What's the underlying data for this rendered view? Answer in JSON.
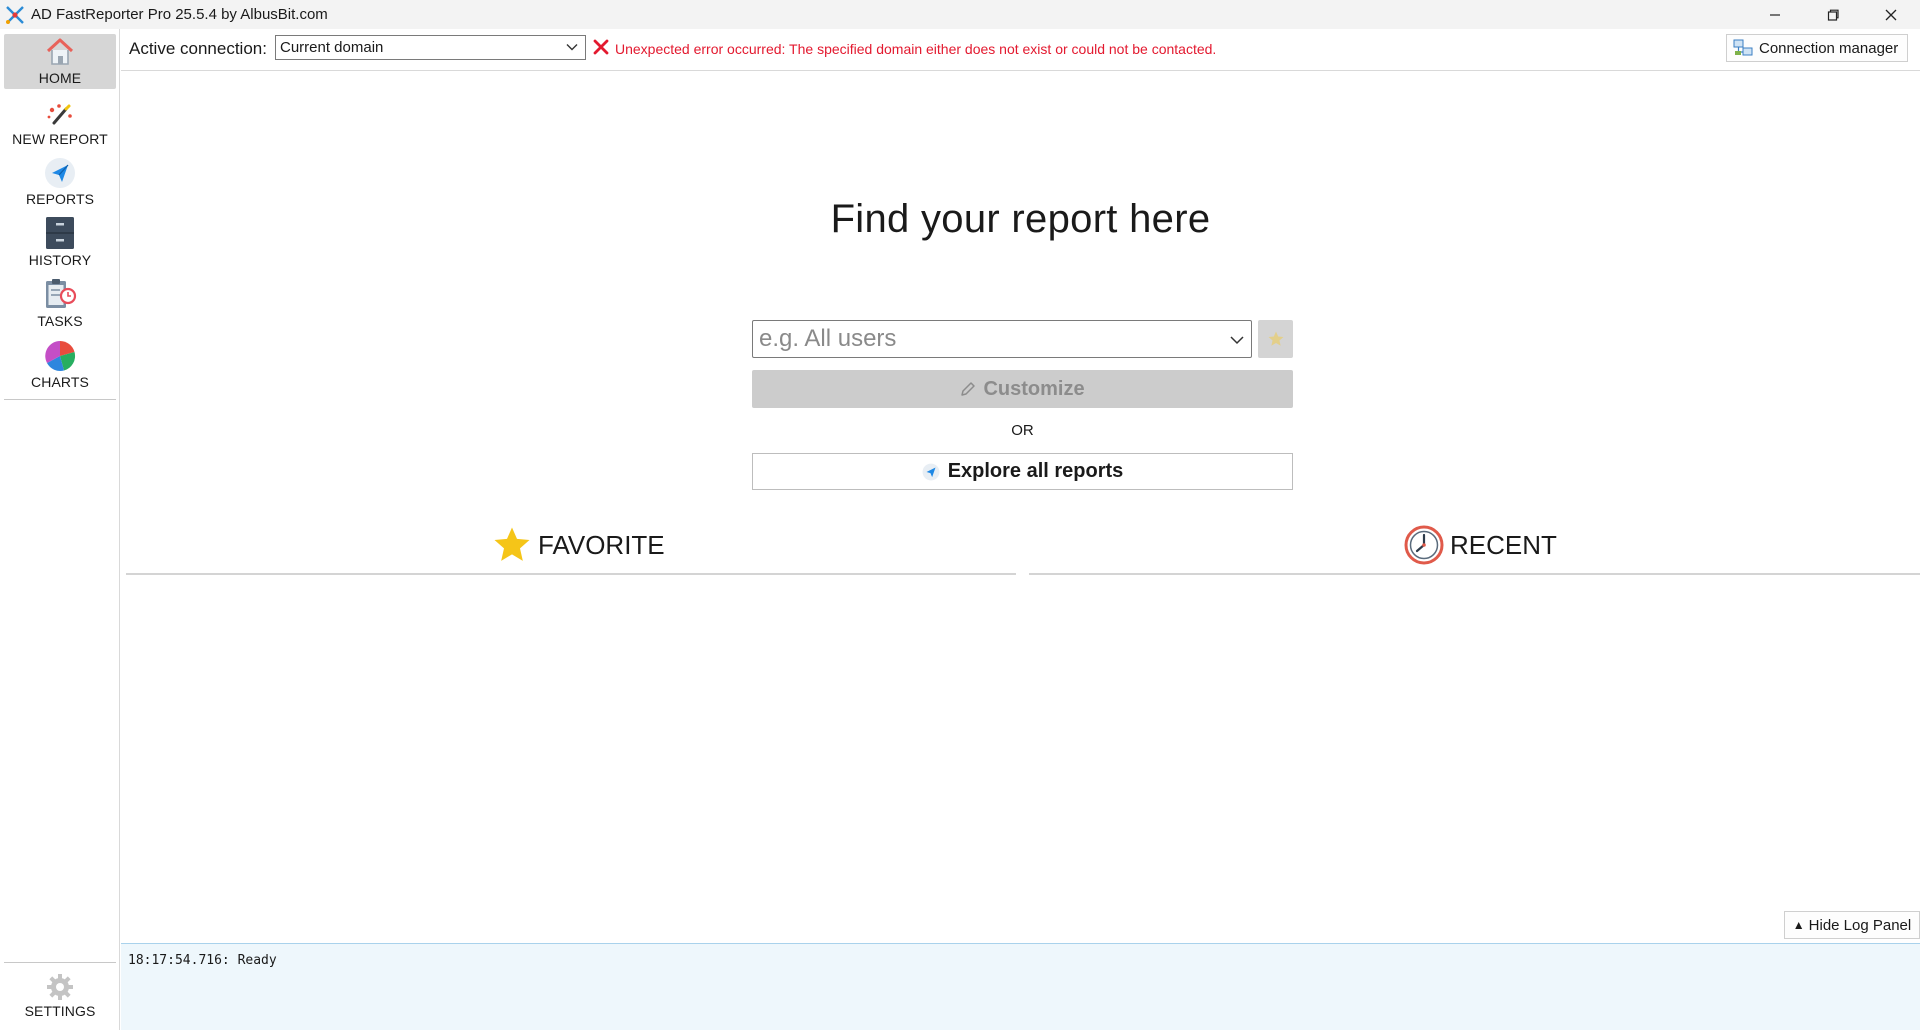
{
  "window": {
    "title": "AD FastReporter Pro 25.5.4 by AlbusBit.com",
    "app_icon": "albusbit-logo-icon",
    "controls": [
      "minimize-icon",
      "restore-icon",
      "close-icon"
    ]
  },
  "sidebar": {
    "items": [
      {
        "label": "HOME",
        "icon": "home-icon",
        "active": true
      },
      {
        "label": "NEW REPORT",
        "icon": "magic-wand-icon"
      },
      {
        "label": "REPORTS",
        "icon": "paper-plane-icon"
      },
      {
        "label": "HISTORY",
        "icon": "cabinet-icon"
      },
      {
        "label": "TASKS",
        "icon": "clipboard-clock-icon"
      },
      {
        "label": "CHARTS",
        "icon": "pie-chart-icon"
      }
    ],
    "settings": {
      "label": "SETTINGS",
      "icon": "gear-icon"
    }
  },
  "connection": {
    "label": "Active connection:",
    "selected": "Current domain",
    "error": "Unexpected error occurred: The specified domain either does not exist or could not be contacted.",
    "manager_label": "Connection manager"
  },
  "main": {
    "title": "Find your report here",
    "search_placeholder": "e.g. All users",
    "customize_label": "Customize",
    "or_label": "OR",
    "explore_label": "Explore all reports",
    "favorite_label": "FAVORITE",
    "recent_label": "RECENT"
  },
  "log": {
    "hide_label": "Hide Log Panel",
    "lines": [
      "18:17:54.716: Ready"
    ]
  },
  "colors": {
    "error": "#e3192f",
    "active_nav": "#d6d6d6",
    "log_bg": "#eef7fc"
  }
}
